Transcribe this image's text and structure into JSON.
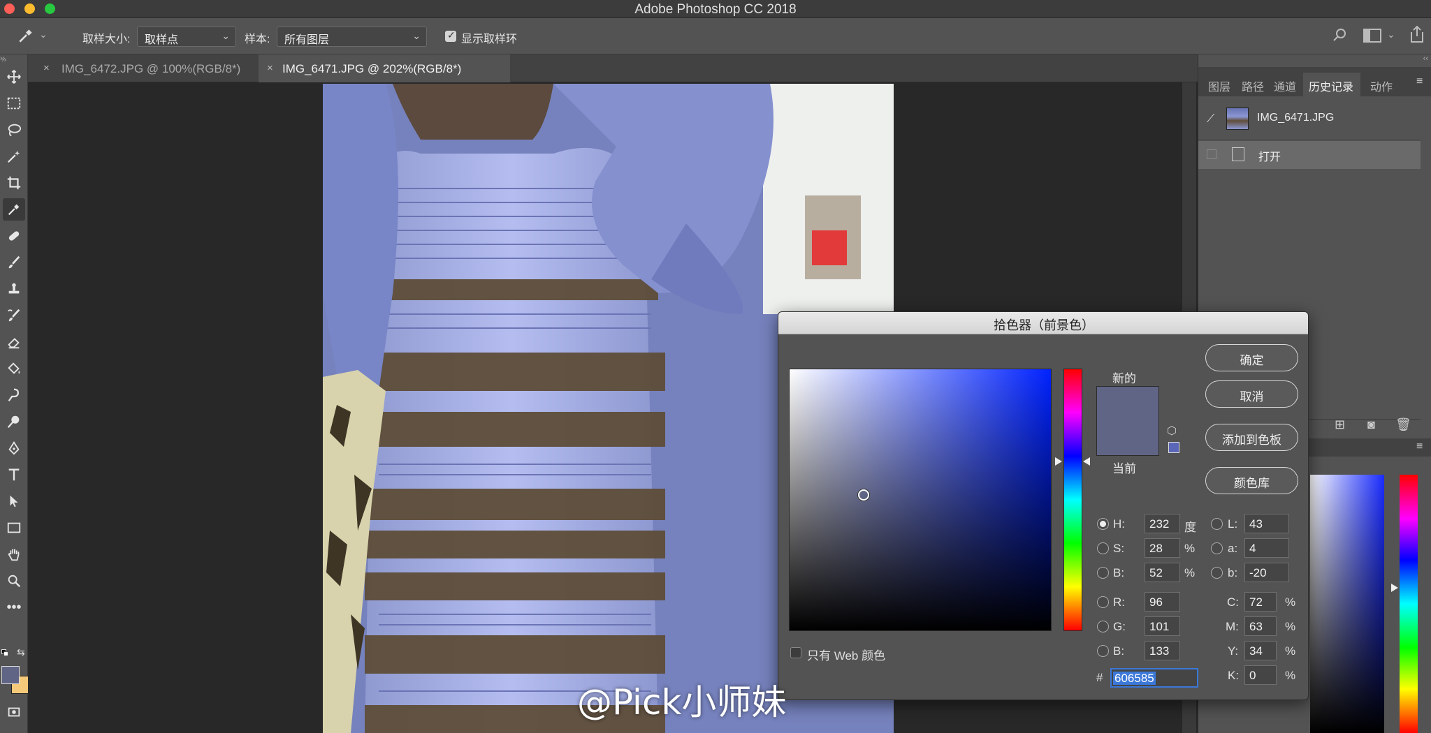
{
  "window": {
    "title": "Adobe Photoshop CC 2018"
  },
  "options_bar": {
    "sample_size_label": "取样大小:",
    "sample_size_value": "取样点",
    "sample_label": "样本:",
    "sample_value": "所有图层",
    "show_ring_label": "显示取样环",
    "show_ring_checked": true
  },
  "document_tabs": [
    {
      "label": "IMG_6472.JPG @ 100%(RGB/8*)",
      "active": false
    },
    {
      "label": "IMG_6471.JPG @ 202%(RGB/8*)",
      "active": true
    }
  ],
  "right_panel": {
    "tabs": [
      "图层",
      "路径",
      "通道",
      "历史记录",
      "动作"
    ],
    "active_tab": "历史记录",
    "history_snapshot": "IMG_6471.JPG",
    "history_items": [
      "打开"
    ]
  },
  "color_picker": {
    "title": "拾色器（前景色）",
    "new_label": "新的",
    "current_label": "当前",
    "buttons": {
      "ok": "确定",
      "cancel": "取消",
      "add_swatch": "添加到色板",
      "libraries": "颜色库"
    },
    "web_only_label": "只有 Web 颜色",
    "fields": {
      "H": {
        "label": "H:",
        "value": "232",
        "unit": "度"
      },
      "S": {
        "label": "S:",
        "value": "28",
        "unit": "%"
      },
      "Bv": {
        "label": "B:",
        "value": "52",
        "unit": "%"
      },
      "R": {
        "label": "R:",
        "value": "96"
      },
      "G": {
        "label": "G:",
        "value": "101"
      },
      "Bc": {
        "label": "B:",
        "value": "133"
      },
      "L": {
        "label": "L:",
        "value": "43"
      },
      "a": {
        "label": "a:",
        "value": "4"
      },
      "b": {
        "label": "b:",
        "value": "-20"
      },
      "C": {
        "label": "C:",
        "value": "72",
        "unit": "%"
      },
      "M": {
        "label": "M:",
        "value": "63",
        "unit": "%"
      },
      "Y": {
        "label": "Y:",
        "value": "34",
        "unit": "%"
      },
      "K": {
        "label": "K:",
        "value": "0",
        "unit": "%"
      }
    },
    "hex_prefix": "#",
    "hex_value": "606585",
    "color_hex": "#606585"
  },
  "watermark": "@Pick小师妹",
  "colors": {
    "foreground": "#606585",
    "background": "#f5c97a",
    "accent": "#3b78d8"
  }
}
